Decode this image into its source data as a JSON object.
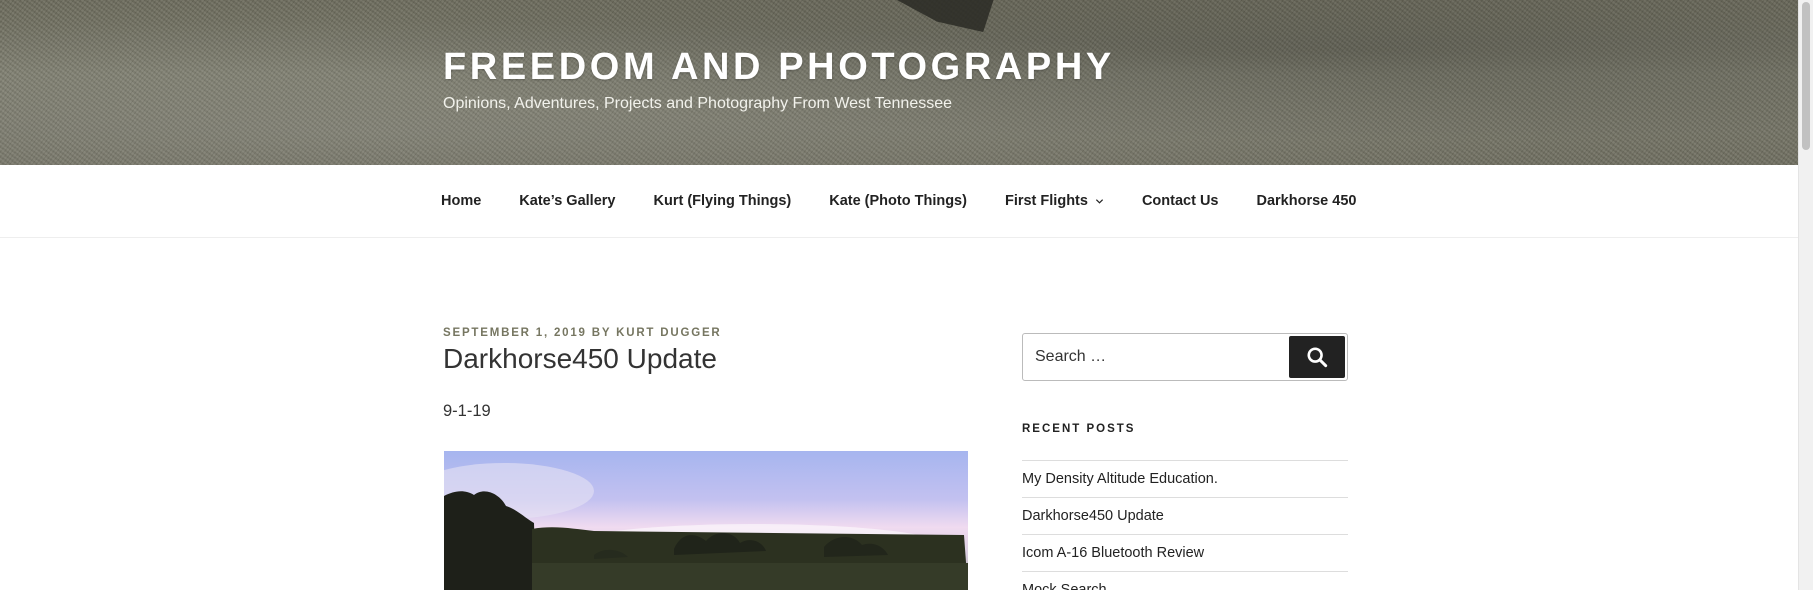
{
  "header": {
    "site_title": "FREEDOM AND PHOTOGRAPHY",
    "site_description": "Opinions, Adventures, Projects and Photography From West Tennessee"
  },
  "nav": {
    "items": [
      {
        "label": "Home"
      },
      {
        "label": "Kate’s Gallery"
      },
      {
        "label": "Kurt (Flying Things)"
      },
      {
        "label": "Kate (Photo Things)"
      },
      {
        "label": "First Flights",
        "has_submenu": true
      },
      {
        "label": "Contact Us"
      },
      {
        "label": "Darkhorse 450"
      }
    ]
  },
  "post": {
    "date": "SEPTEMBER 1, 2019",
    "by": "BY",
    "author": "KURT DUGGER",
    "title": "Darkhorse450 Update",
    "body_date": "9-1-19"
  },
  "sidebar": {
    "search_placeholder": "Search …",
    "recent_posts_title": "RECENT POSTS",
    "recent_posts": [
      "My Density Altitude Education.",
      "Darkhorse450 Update",
      "Icom A-16 Bluetooth Review",
      "Mock Search"
    ]
  },
  "colors": {
    "meta_text": "#767661",
    "search_button": "#222222",
    "header_overlay": "#6f6e60"
  }
}
